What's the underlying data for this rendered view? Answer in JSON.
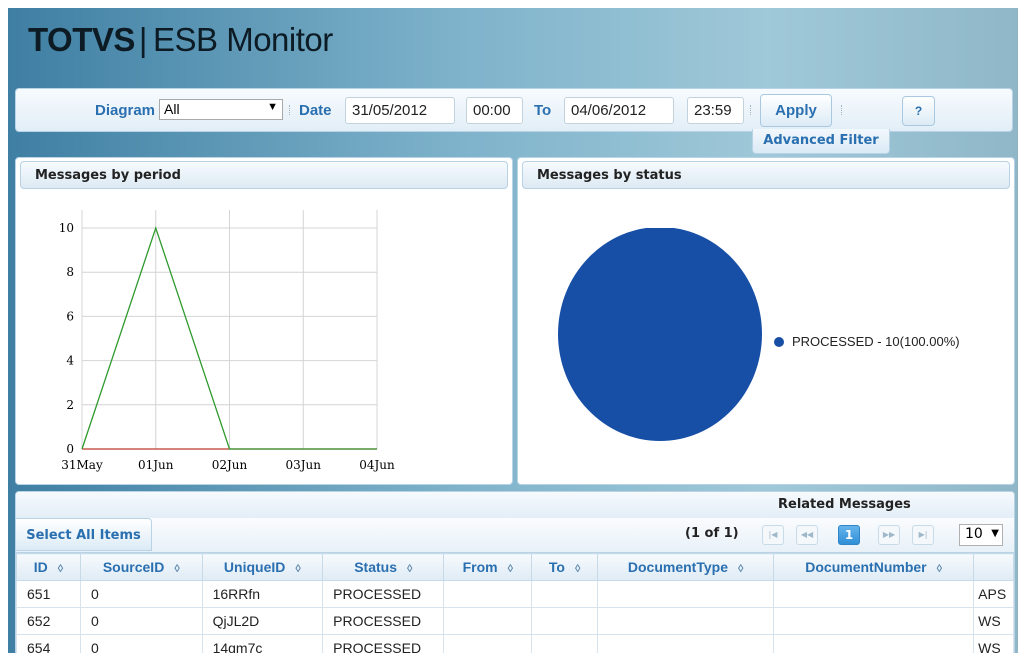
{
  "header": {
    "brand": "TOTVS",
    "separator": "|",
    "title": "ESB Monitor"
  },
  "filter": {
    "diagram_label": "Diagram",
    "diagram_value": "All",
    "date_label": "Date",
    "date_from": "31/05/2012",
    "time_from": "00:00",
    "to_label": "To",
    "date_to": "04/06/2012",
    "time_to": "23:59",
    "apply_label": "Apply",
    "help_label": "?",
    "advanced_filter_label": "Advanced Filter"
  },
  "period_panel": {
    "title": "Messages by period"
  },
  "status_panel": {
    "title": "Messages by status",
    "legend": "PROCESSED - 10(100.00%)"
  },
  "chart_data": [
    {
      "type": "line",
      "categories": [
        "31May",
        "01Jun",
        "02Jun",
        "03Jun",
        "04Jun"
      ],
      "y_ticks": [
        "0",
        "2",
        "4",
        "6",
        "8",
        "10"
      ],
      "ylim": [
        0,
        10
      ],
      "grid": true,
      "series": [
        {
          "values": [
            0,
            10,
            0,
            0,
            0
          ],
          "color": "#2e9a2e"
        },
        {
          "values": [
            0,
            0,
            0,
            0,
            0
          ],
          "color": "#c0392b"
        }
      ]
    },
    {
      "type": "pie",
      "slices": [
        {
          "label": "PROCESSED - 10(100.00%)",
          "value": 10,
          "color": "#184fa6"
        }
      ],
      "legend_position": "right"
    }
  ],
  "related": {
    "title": "Related Messages",
    "select_all_label": "Select All Items",
    "page_info": "(1 of 1)",
    "current_page": "1",
    "rows_per_page": "10",
    "columns": [
      "ID",
      "SourceID",
      "UniqueID",
      "Status",
      "From",
      "To",
      "DocumentType",
      "DocumentNumber",
      ""
    ],
    "rows": [
      [
        "651",
        "0",
        "16RRfn",
        "PROCESSED",
        "",
        "",
        "",
        "",
        "APS"
      ],
      [
        "652",
        "0",
        "QjJL2D",
        "PROCESSED",
        "",
        "",
        "",
        "",
        "WS"
      ],
      [
        "654",
        "0",
        "14gm7c",
        "PROCESSED",
        "",
        "",
        "",
        "",
        "WS"
      ]
    ]
  }
}
